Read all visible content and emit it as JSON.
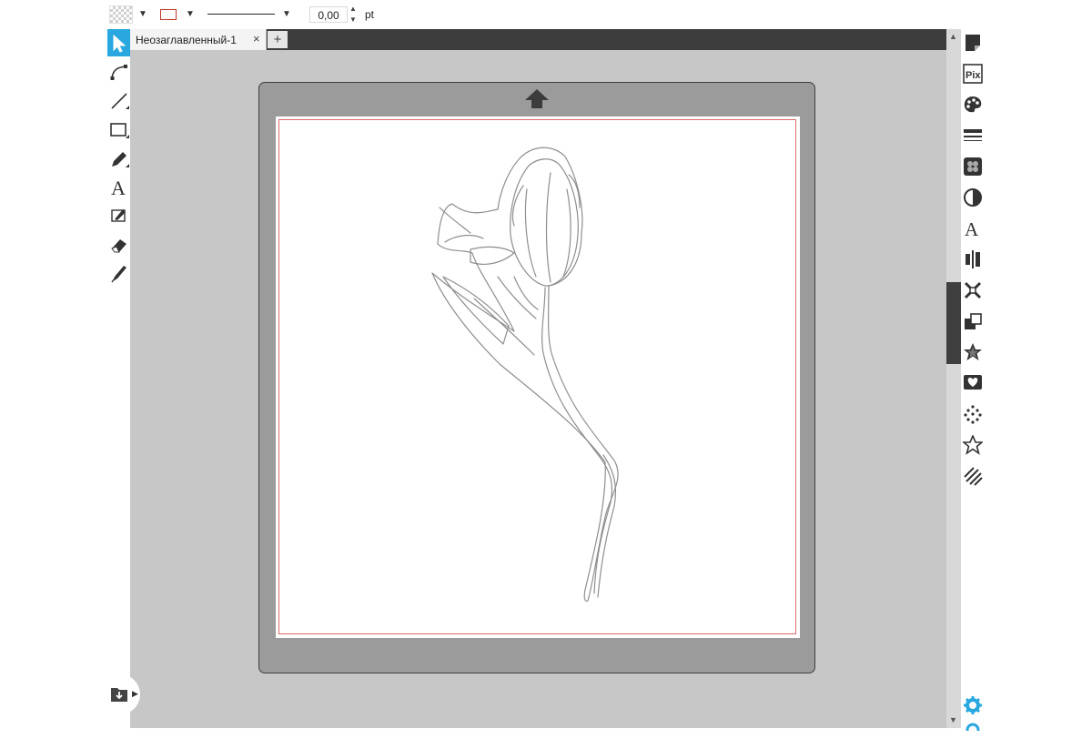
{
  "toolbar": {
    "stroke_width_value": "0,00",
    "stroke_width_unit": "pt",
    "stroke_color": "#c0392b"
  },
  "tabs": [
    {
      "label": "Неозаглавленный-1",
      "close": "×",
      "active": true
    }
  ],
  "tab_add_label": "+",
  "left_tools": [
    "select-pointer-icon",
    "bezier-curve-icon",
    "line-icon",
    "rectangle-icon",
    "pencil-icon",
    "text-icon",
    "knife-icon",
    "eraser-icon",
    "pen-icon"
  ],
  "right_panel_tools": [
    "page-setup-icon",
    "pixscan-icon",
    "fill-color-icon",
    "line-style-icon",
    "image-effects-icon",
    "transparency-icon",
    "text-style-icon",
    "align-icon",
    "replicate-icon",
    "modify-icon",
    "offset-icon",
    "trace-icon",
    "sketch-icon",
    "rhinestone-icon",
    "star-icon",
    "hatch-icon",
    "settings-icon"
  ],
  "colors": {
    "accent": "#29a8df",
    "canvas_background": "#c7c7c7",
    "mat": "#9b9b9b",
    "cut_border": "#e06b6b",
    "outline": "#8e8e8e"
  }
}
